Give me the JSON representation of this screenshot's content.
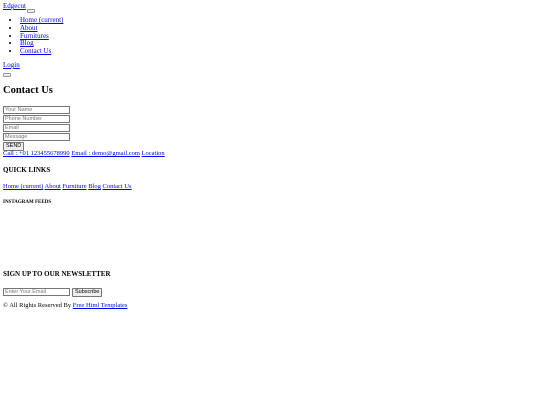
{
  "header": {
    "brand": "Edgecut",
    "nav": [
      "Home (current)",
      "About",
      "Furnitures",
      "Blog",
      "Contact Us"
    ],
    "login": "Login"
  },
  "contact": {
    "title": "Contact Us",
    "name_placeholder": "Your Name",
    "phone_placeholder": "Phone Number",
    "email_placeholder": "Email",
    "message_placeholder": "Message",
    "send_label": "SEND"
  },
  "info": {
    "phone": "Call : +01 123455678990",
    "email": "Email : demo@gmail.com",
    "location": "Location"
  },
  "quick_links": {
    "title": "QUICK LINKS",
    "items": [
      "Home (current)",
      "About",
      "Furniture",
      "Blog",
      "Contact Us"
    ]
  },
  "instagram": {
    "title": "INSTAGRAM FEEDS"
  },
  "newsletter": {
    "title": "SIGN UP TO OUR NEWSLETTER",
    "email_placeholder": "Enter Your Email",
    "subscribe_label": "Subscribe"
  },
  "footer": {
    "copyright": "© All Rights Reserved By",
    "link": "Free Html Templates"
  }
}
